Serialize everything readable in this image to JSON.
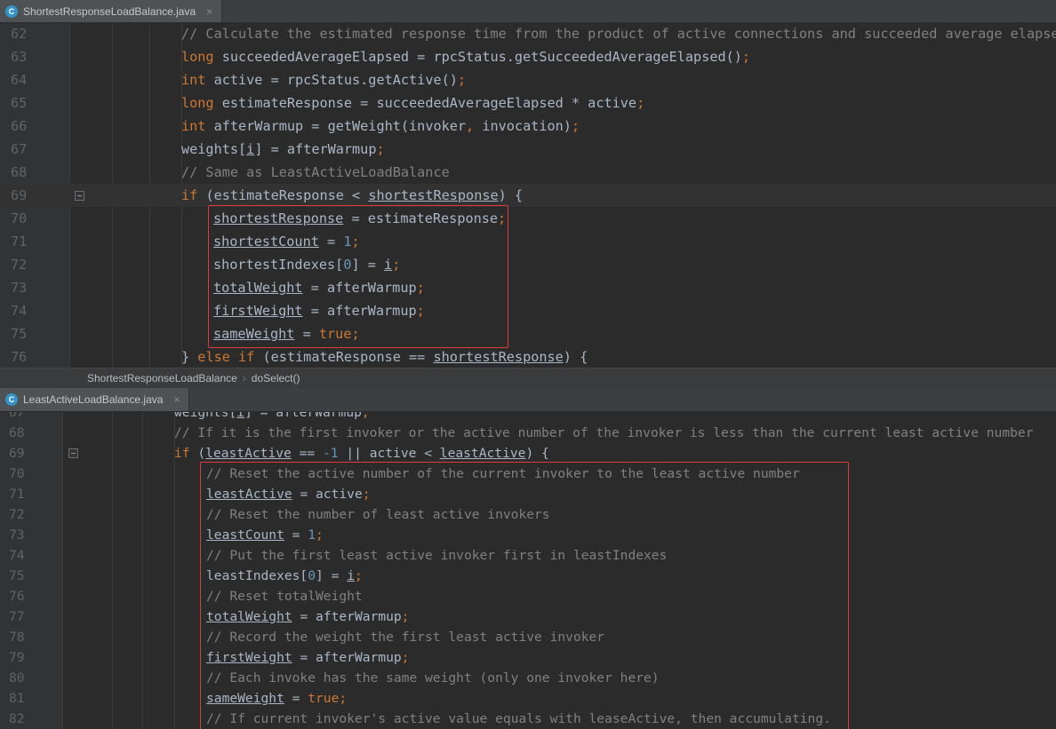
{
  "top_tab": {
    "label": "ShortestResponseLoadBalance.java",
    "icon": "java-class-icon"
  },
  "bottom_tab": {
    "label": "LeastActiveLoadBalance.java",
    "icon": "java-class-icon"
  },
  "breadcrumb": {
    "items": [
      "ShortestResponseLoadBalance",
      "doSelect()"
    ]
  },
  "top_editor": {
    "lines": [
      {
        "n": "62",
        "t": [
          [
            "cm",
            "// Calculate the estimated response time from the product of active connections and succeeded average elapsed"
          ]
        ]
      },
      {
        "n": "63",
        "t": [
          [
            "kw",
            "long"
          ],
          [
            "tx",
            " succeededAverageElapsed = rpcStatus.getSucceededAverageElapsed()"
          ],
          [
            "kw",
            ";"
          ]
        ]
      },
      {
        "n": "64",
        "t": [
          [
            "kw",
            "int"
          ],
          [
            "tx",
            " active = rpcStatus.getActive()"
          ],
          [
            "kw",
            ";"
          ]
        ]
      },
      {
        "n": "65",
        "t": [
          [
            "kw",
            "long"
          ],
          [
            "tx",
            " estimateResponse = succeededAverageElapsed * active"
          ],
          [
            "kw",
            ";"
          ]
        ]
      },
      {
        "n": "66",
        "t": [
          [
            "kw",
            "int"
          ],
          [
            "tx",
            " afterWarmup = getWeight(invoker"
          ],
          [
            "kw",
            ","
          ],
          [
            "tx",
            " invocation)"
          ],
          [
            "kw",
            ";"
          ]
        ]
      },
      {
        "n": "67",
        "t": [
          [
            "tx",
            "weights["
          ],
          [
            "tu",
            "i"
          ],
          [
            "tx",
            "] = afterWarmup"
          ],
          [
            "kw",
            ";"
          ]
        ]
      },
      {
        "n": "68",
        "t": [
          [
            "cm",
            "// Same as LeastActiveLoadBalance"
          ]
        ]
      },
      {
        "n": "69",
        "t": [
          [
            "kw",
            "if"
          ],
          [
            "tx",
            " (estimateResponse < "
          ],
          [
            "tu",
            "shortestResponse"
          ],
          [
            "tx",
            ") {"
          ]
        ]
      },
      {
        "n": "70",
        "t": [
          [
            "tu",
            "shortestResponse"
          ],
          [
            "tx",
            " = estimateResponse"
          ],
          [
            "kw",
            ";"
          ]
        ]
      },
      {
        "n": "71",
        "t": [
          [
            "tu",
            "shortestCount"
          ],
          [
            "tx",
            " = "
          ],
          [
            "nm",
            "1"
          ],
          [
            "kw",
            ";"
          ]
        ]
      },
      {
        "n": "72",
        "t": [
          [
            "tx",
            "shortestIndexes["
          ],
          [
            "nm",
            "0"
          ],
          [
            "tx",
            "] = "
          ],
          [
            "tu",
            "i"
          ],
          [
            "kw",
            ";"
          ]
        ]
      },
      {
        "n": "73",
        "t": [
          [
            "tu",
            "totalWeight"
          ],
          [
            "tx",
            " = afterWarmup"
          ],
          [
            "kw",
            ";"
          ]
        ]
      },
      {
        "n": "74",
        "t": [
          [
            "tu",
            "firstWeight"
          ],
          [
            "tx",
            " = afterWarmup"
          ],
          [
            "kw",
            ";"
          ]
        ]
      },
      {
        "n": "75",
        "t": [
          [
            "tu",
            "sameWeight"
          ],
          [
            "tx",
            " = "
          ],
          [
            "kw",
            "true;"
          ]
        ]
      },
      {
        "n": "76",
        "t": [
          [
            "tx",
            "} "
          ],
          [
            "kw",
            "else if"
          ],
          [
            "tx",
            " (estimateResponse == "
          ],
          [
            "tu",
            "shortestResponse"
          ],
          [
            "tx",
            ") {"
          ]
        ]
      }
    ]
  },
  "bottom_editor": {
    "lines": [
      {
        "n": "67",
        "t": [
          [
            "tx",
            "weights["
          ],
          [
            "tu",
            "i"
          ],
          [
            "tx",
            "] = afterWarmup"
          ],
          [
            "kw",
            ";"
          ]
        ]
      },
      {
        "n": "68",
        "t": [
          [
            "cm",
            "// If it is the first invoker or the active number of the invoker is less than the current least active number"
          ]
        ]
      },
      {
        "n": "69",
        "t": [
          [
            "kw",
            "if"
          ],
          [
            "tx",
            " ("
          ],
          [
            "tu",
            "leastActive"
          ],
          [
            "tx",
            " == "
          ],
          [
            "nm",
            "-1"
          ],
          [
            "tx",
            " || active < "
          ],
          [
            "tu",
            "leastActive"
          ],
          [
            "tx",
            ") {"
          ]
        ]
      },
      {
        "n": "70",
        "t": [
          [
            "cm",
            "// Reset the active number of the current invoker to the least active number"
          ]
        ]
      },
      {
        "n": "71",
        "t": [
          [
            "tu",
            "leastActive"
          ],
          [
            "tx",
            " = active"
          ],
          [
            "kw",
            ";"
          ]
        ]
      },
      {
        "n": "72",
        "t": [
          [
            "cm",
            "// Reset the number of least active invokers"
          ]
        ]
      },
      {
        "n": "73",
        "t": [
          [
            "tu",
            "leastCount"
          ],
          [
            "tx",
            " = "
          ],
          [
            "nm",
            "1"
          ],
          [
            "kw",
            ";"
          ]
        ]
      },
      {
        "n": "74",
        "t": [
          [
            "cm",
            "// Put the first least active invoker first in leastIndexes"
          ]
        ]
      },
      {
        "n": "75",
        "t": [
          [
            "tx",
            "leastIndexes["
          ],
          [
            "nm",
            "0"
          ],
          [
            "tx",
            "] = "
          ],
          [
            "tu",
            "i"
          ],
          [
            "kw",
            ";"
          ]
        ]
      },
      {
        "n": "76",
        "t": [
          [
            "cm",
            "// Reset totalWeight"
          ]
        ]
      },
      {
        "n": "77",
        "t": [
          [
            "tu",
            "totalWeight"
          ],
          [
            "tx",
            " = afterWarmup"
          ],
          [
            "kw",
            ";"
          ]
        ]
      },
      {
        "n": "78",
        "t": [
          [
            "cm",
            "// Record the weight the first least active invoker"
          ]
        ]
      },
      {
        "n": "79",
        "t": [
          [
            "tu",
            "firstWeight"
          ],
          [
            "tx",
            " = afterWarmup"
          ],
          [
            "kw",
            ";"
          ]
        ]
      },
      {
        "n": "80",
        "t": [
          [
            "cm",
            "// Each invoke has the same weight (only one invoker here)"
          ]
        ]
      },
      {
        "n": "81",
        "t": [
          [
            "tu",
            "sameWeight"
          ],
          [
            "tx",
            " = "
          ],
          [
            "kw",
            "true;"
          ]
        ]
      },
      {
        "n": "82",
        "t": [
          [
            "cm",
            "// If current invoker's active value equals with leaseActive, then accumulating."
          ]
        ]
      }
    ]
  },
  "colors": {
    "background": "#2b2b2b",
    "keyword": "#cc7832",
    "comment": "#808080",
    "number": "#6897bb",
    "text": "#a9b7c6",
    "highlight_box": "#e0393e"
  }
}
